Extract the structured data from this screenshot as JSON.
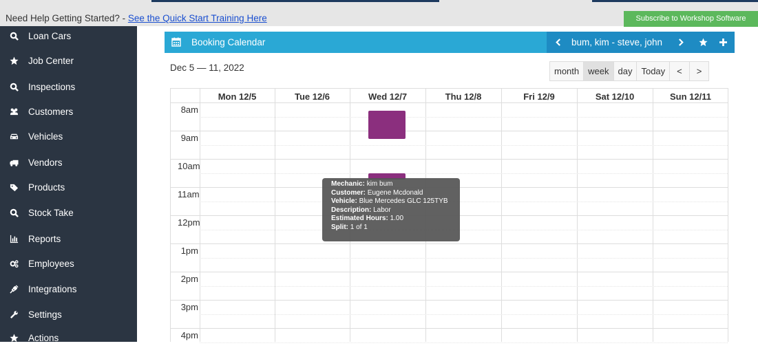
{
  "banner": {
    "help_text": "Need Help Getting Started? - ",
    "help_link": "See the Quick Start Training Here",
    "subscribe_label": "Subscribe to Workshop Software"
  },
  "sidebar": {
    "items": [
      {
        "label": "Loan Cars",
        "icon": "search-icon"
      },
      {
        "label": "Job Center",
        "icon": "star-icon"
      },
      {
        "label": "Inspections",
        "icon": "search-icon"
      },
      {
        "label": "Customers",
        "icon": "users-icon"
      },
      {
        "label": "Vehicles",
        "icon": "car-icon"
      },
      {
        "label": "Vendors",
        "icon": "truck-icon"
      },
      {
        "label": "Products",
        "icon": "tag-icon"
      },
      {
        "label": "Stock Take",
        "icon": "search-icon"
      },
      {
        "label": "Reports",
        "icon": "bar-chart-icon"
      },
      {
        "label": "Employees",
        "icon": "cogs-icon"
      },
      {
        "label": "Integrations",
        "icon": "plug-icon"
      },
      {
        "label": "Settings",
        "icon": "wrench-icon"
      },
      {
        "label": "Actions",
        "icon": "star-icon"
      }
    ]
  },
  "calendar": {
    "title": "Booking Calendar",
    "mechanics": "bum, kim - steve, john",
    "date_range": "Dec 5 — 11, 2022",
    "views": [
      "month",
      "week",
      "day"
    ],
    "active_view": "week",
    "today_label": "Today",
    "prev_symbol": "<",
    "next_symbol": ">",
    "days": [
      "Mon 12/5",
      "Tue 12/6",
      "Wed 12/7",
      "Thu 12/8",
      "Fri 12/9",
      "Sat 12/10",
      "Sun 12/11"
    ],
    "hours": [
      "8am",
      "9am",
      "10am",
      "11am",
      "12pm",
      "1pm",
      "2pm",
      "3pm",
      "4pm"
    ],
    "event_color": "#8b2f7e",
    "header_color": "#2aa8d5"
  },
  "tooltip": {
    "mechanic_label": "Mechanic:",
    "mechanic": "kim bum",
    "customer_label": "Customer:",
    "customer": "Eugene Mcdonald",
    "vehicle_label": "Vehicle:",
    "vehicle": "Blue Mercedes GLC 125TYB",
    "description_label": "Description:",
    "description": "Labor",
    "hours_label": "Estimated Hours:",
    "hours": "1.00",
    "split_label": "Split:",
    "split": "1 of 1"
  }
}
